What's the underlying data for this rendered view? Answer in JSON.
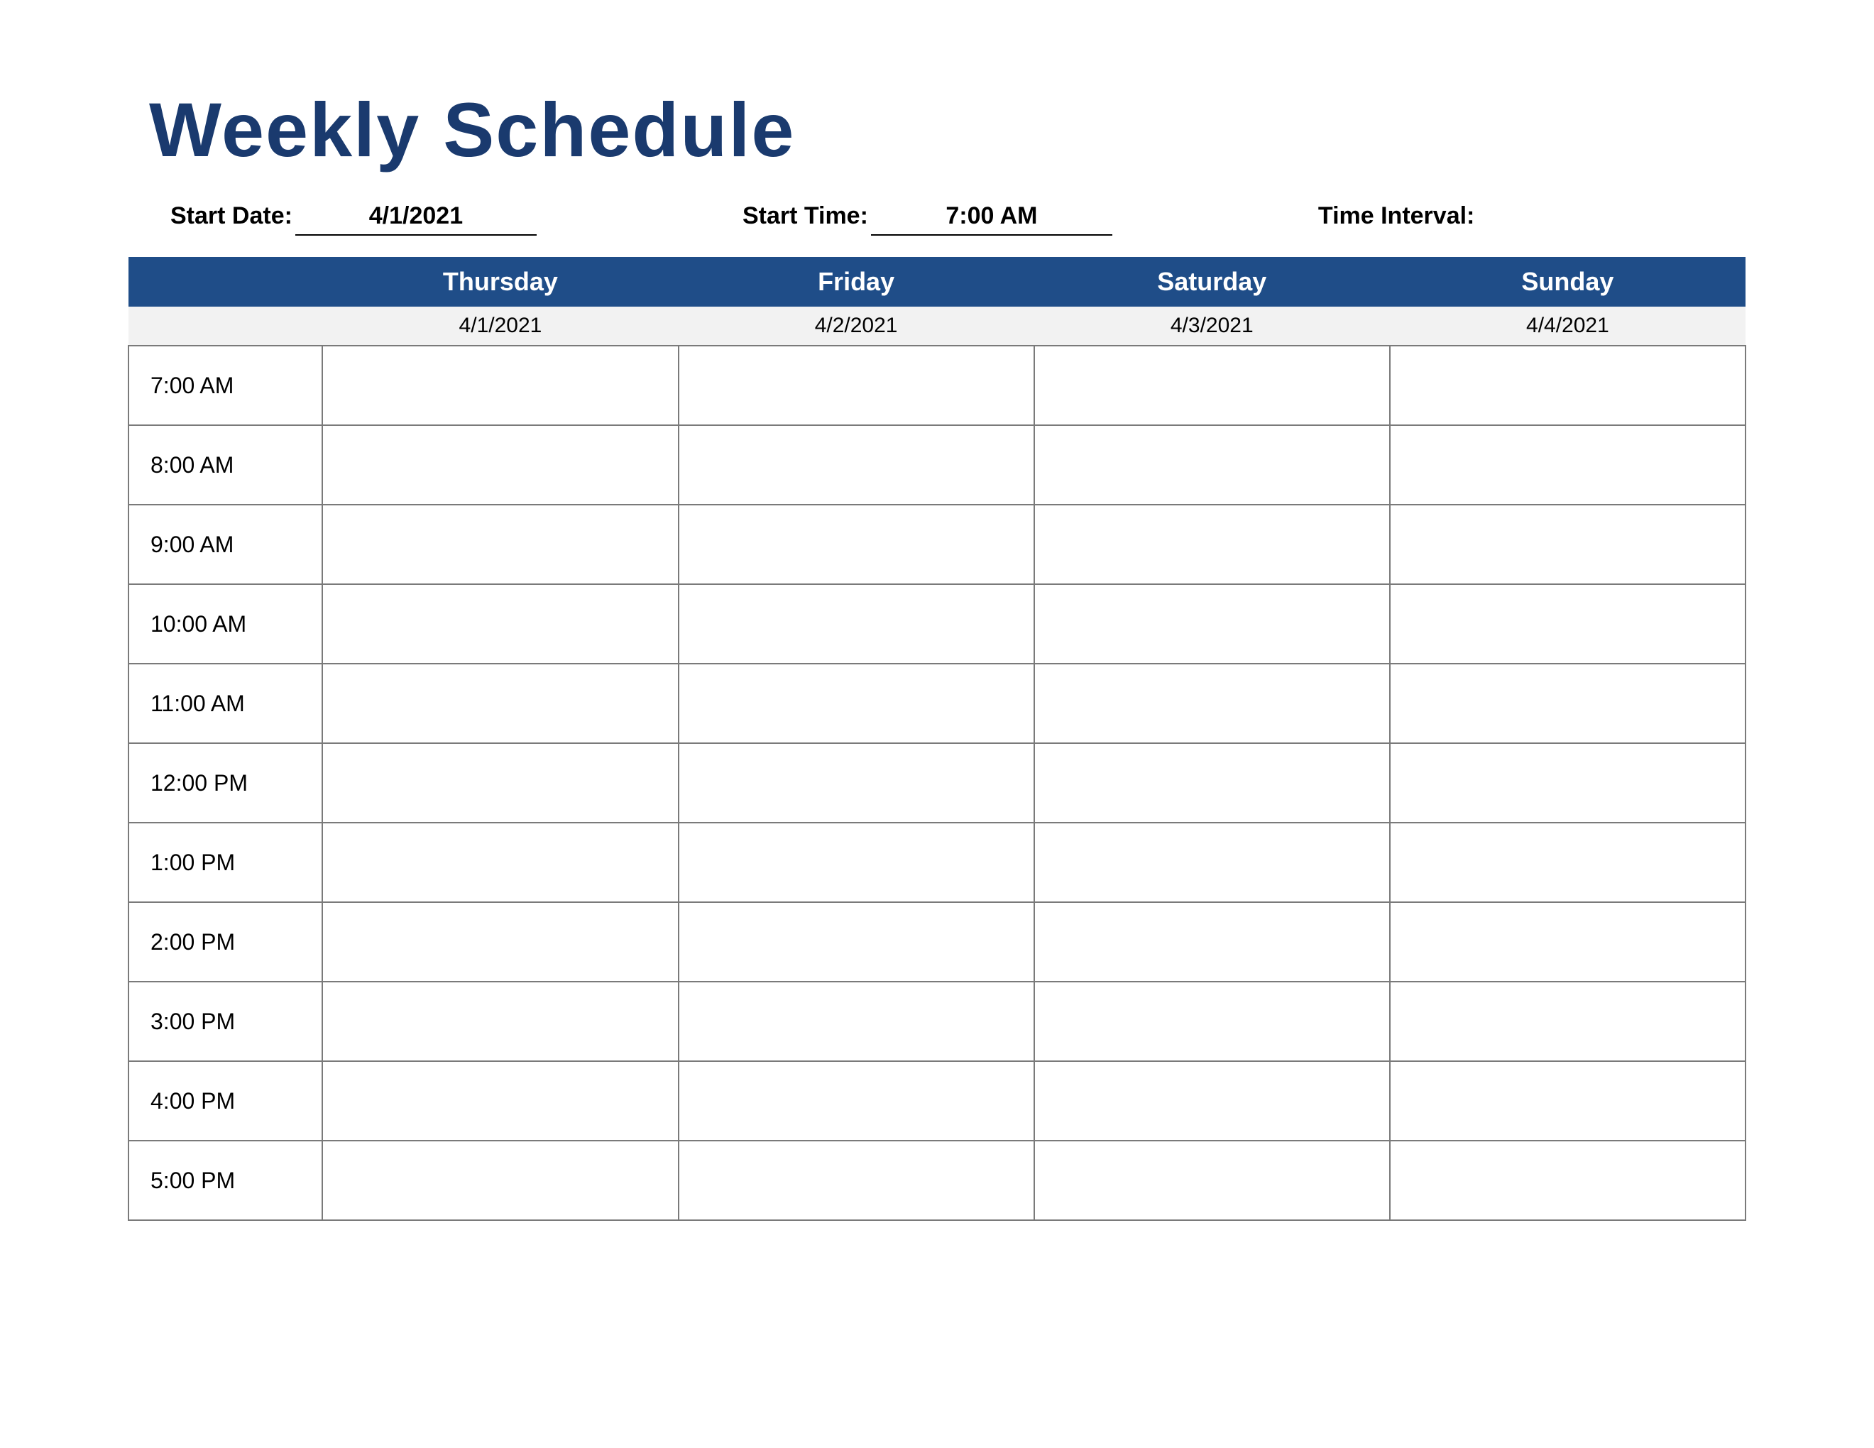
{
  "title": "Weekly Schedule",
  "meta": {
    "start_date_label": "Start Date:",
    "start_date_value": "4/1/2021",
    "start_time_label": "Start Time:",
    "start_time_value": "7:00 AM",
    "time_interval_label": "Time Interval:"
  },
  "days": [
    {
      "name": "Thursday",
      "date": "4/1/2021"
    },
    {
      "name": "Friday",
      "date": "4/2/2021"
    },
    {
      "name": "Saturday",
      "date": "4/3/2021"
    },
    {
      "name": "Sunday",
      "date": "4/4/2021"
    }
  ],
  "times": [
    "7:00 AM",
    "8:00 AM",
    "9:00 AM",
    "10:00 AM",
    "11:00 AM",
    "12:00 PM",
    "1:00 PM",
    "2:00 PM",
    "3:00 PM",
    "4:00 PM",
    "5:00 PM"
  ]
}
